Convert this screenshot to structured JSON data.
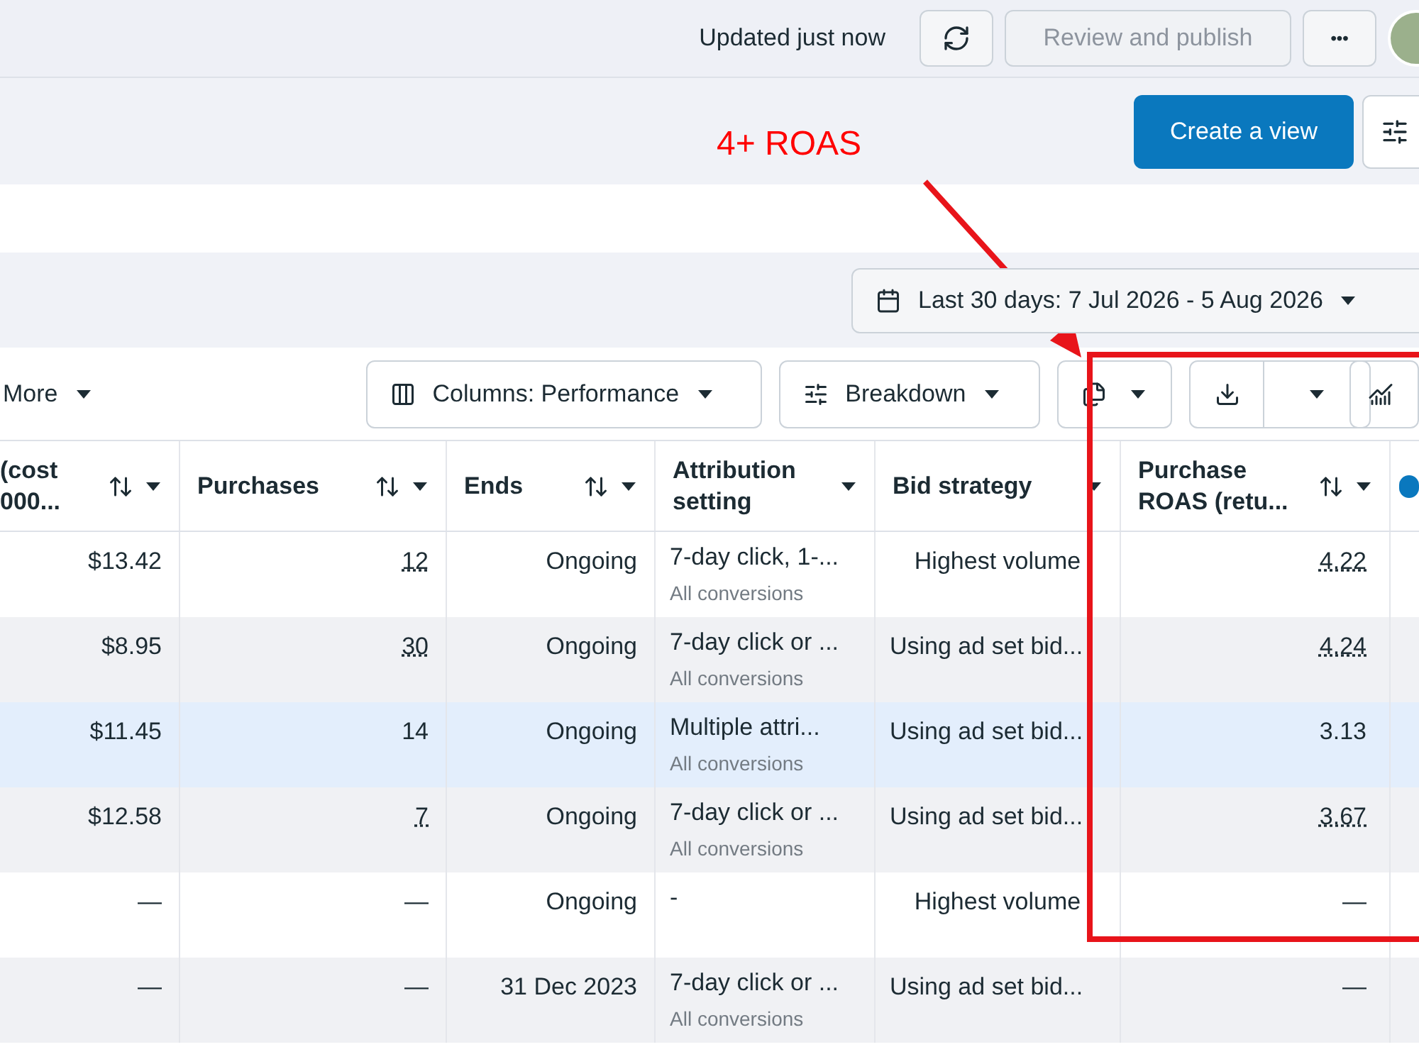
{
  "header": {
    "status": "Updated just now",
    "publish_button": {
      "label": "Review and publish",
      "disabled": true
    },
    "more_button": "•••"
  },
  "view_bar": {
    "create_button": "Create a view"
  },
  "annotation": {
    "label": "4+ ROAS"
  },
  "date_range": "Last 30 days: 7 Jul 2026 - 5 Aug 2026",
  "toolbar": {
    "more": "More",
    "columns_button": "Columns: Performance",
    "breakdown_button": "Breakdown"
  },
  "table": {
    "columns": [
      {
        "lines": [
          "(cost",
          "000..."
        ],
        "sortable": true,
        "menu": true
      },
      {
        "lines": [
          "Purchases"
        ],
        "sortable": true,
        "menu": true
      },
      {
        "lines": [
          "Ends"
        ],
        "sortable": true,
        "menu": true
      },
      {
        "lines": [
          "Attribution",
          "setting"
        ],
        "sortable": false,
        "menu": true
      },
      {
        "lines": [
          "Bid strategy"
        ],
        "sortable": false,
        "menu": true
      },
      {
        "lines": [
          "Purchase",
          "ROAS (retu..."
        ],
        "sortable": true,
        "menu": true
      }
    ],
    "rows": [
      {
        "shaded": false,
        "highlighted": false,
        "cost": "$13.42",
        "purchases": "12",
        "purchases_dotted": true,
        "ends": "Ongoing",
        "attribution": "7-day click, 1-...",
        "attribution_sub": "All conversions",
        "bid": "Highest volume",
        "bid_centered": true,
        "roas": "4.22",
        "roas_dotted": true
      },
      {
        "shaded": true,
        "highlighted": false,
        "cost": "$8.95",
        "purchases": "30",
        "purchases_dotted": true,
        "ends": "Ongoing",
        "attribution": "7-day click or ...",
        "attribution_sub": "All conversions",
        "bid": "Using ad set bid...",
        "bid_centered": false,
        "roas": "4.24",
        "roas_dotted": true
      },
      {
        "highlighted": true,
        "cost": "$11.45",
        "purchases": "14",
        "purchases_dotted": false,
        "ends": "Ongoing",
        "attribution": "Multiple attri...",
        "attribution_sub": "All conversions",
        "bid": "Using ad set bid...",
        "bid_centered": false,
        "roas": "3.13",
        "roas_dotted": false
      },
      {
        "shaded": true,
        "highlighted": false,
        "cost": "$12.58",
        "purchases": "7",
        "purchases_dotted": true,
        "ends": "Ongoing",
        "attribution": "7-day click or ...",
        "attribution_sub": "All conversions",
        "bid": "Using ad set bid...",
        "bid_centered": false,
        "roas": "3.67",
        "roas_dotted": true
      },
      {
        "shaded": false,
        "highlighted": false,
        "cost": "—",
        "purchases": "—",
        "purchases_dotted": false,
        "ends": "Ongoing",
        "attribution": "-",
        "bid": "Highest volume",
        "bid_centered": true,
        "roas": "—",
        "roas_dotted": false
      },
      {
        "shaded": true,
        "highlighted": false,
        "cost": "—",
        "purchases": "—",
        "purchases_dotted": false,
        "ends": "31 Dec 2023",
        "attribution": "7-day click or ...",
        "attribution_sub": "All conversions",
        "bid": "Using ad set bid...",
        "bid_centered": false,
        "roas": "—",
        "roas_dotted": false
      }
    ]
  }
}
